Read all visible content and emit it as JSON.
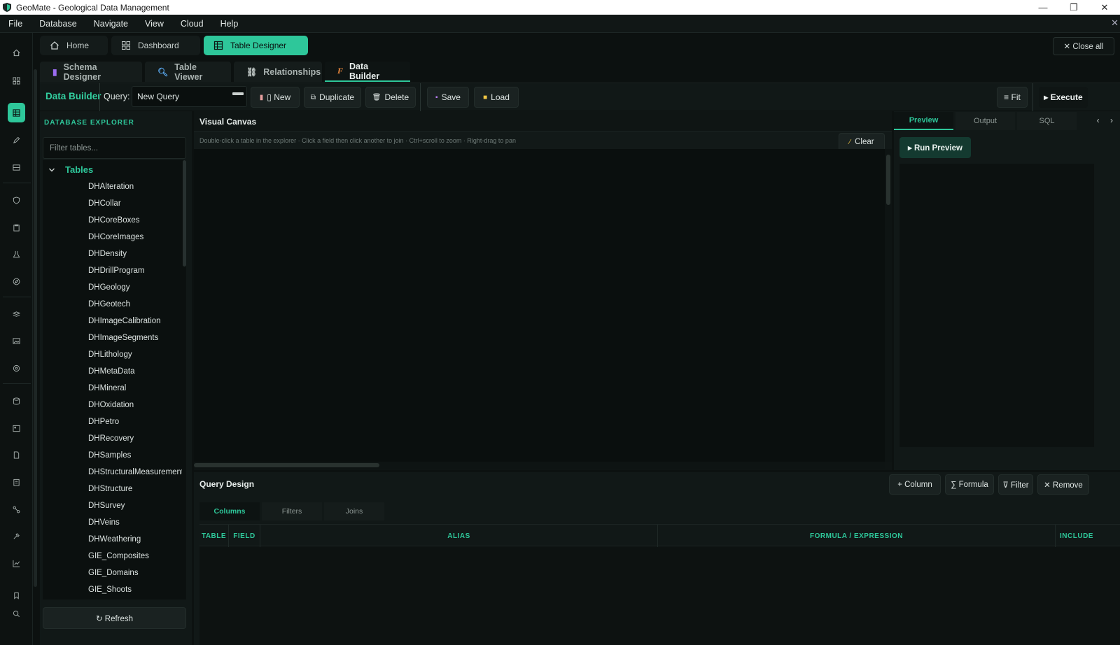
{
  "window": {
    "title": "GeoMate - Geological Data Management",
    "controls": [
      "—",
      "❐",
      "✕"
    ]
  },
  "menu": [
    "File",
    "Database",
    "Navigate",
    "View",
    "Cloud",
    "Help"
  ],
  "menu_close": "✕",
  "top_tabs": [
    {
      "label": "Home",
      "icon": "home-icon"
    },
    {
      "label": "Dashboard",
      "icon": "dashboard-icon"
    },
    {
      "label": "Table Designer",
      "icon": "table-icon",
      "active": true
    }
  ],
  "close_all": "✕  Close all",
  "sub_tabs": [
    {
      "label": "Schema Designer",
      "icon": "schema-icon"
    },
    {
      "label": "Table Viewer",
      "icon": "magnifier-icon"
    },
    {
      "label": "Relationships",
      "icon": "link-icon"
    },
    {
      "label": "Data Builder",
      "icon": "formula-icon",
      "active": true
    }
  ],
  "toolbar": {
    "title": "Data Builder",
    "query_label": "Query:",
    "query_value": "New Query",
    "new": "▯ New",
    "duplicate": "Duplicate",
    "delete": "Delete",
    "save": "Save",
    "load": "Load",
    "fit": "≡ Fit",
    "execute": "▸ Execute"
  },
  "explorer": {
    "title": "DATABASE EXPLORER",
    "filter_placeholder": "Filter tables...",
    "group": "Tables",
    "tables": [
      "DHAlteration",
      "DHCollar",
      "DHCoreBoxes",
      "DHCoreImages",
      "DHDensity",
      "DHDrillProgram",
      "DHGeology",
      "DHGeotech",
      "DHImageCalibration",
      "DHImageSegments",
      "DHLithology",
      "DHMetaData",
      "DHMineral",
      "DHOxidation",
      "DHPetro",
      "DHRecovery",
      "DHSamples",
      "DHStructuralMeasurements",
      "DHStructure",
      "DHSurvey",
      "DHVeins",
      "DHWeathering",
      "GIE_Composites",
      "GIE_Domains",
      "GIE_Shoots"
    ],
    "refresh": "↻ Refresh"
  },
  "canvas": {
    "title": "Visual Canvas",
    "hint": "Double-click a table in the explorer  ·  Click a field then click another to join  ·  Ctrl+scroll to zoom  ·  Right-drag to pan",
    "clear": "Clear"
  },
  "preview": {
    "tabs": [
      "Preview",
      "Output",
      "SQL"
    ],
    "arrows": "‹ ›",
    "run": "▸ Run Preview"
  },
  "query_design": {
    "title": "Query Design",
    "add_column": "+ Column",
    "formula": "∑ Formula",
    "filter": "⊽ Filter",
    "remove": "✕ Remove",
    "tabs": [
      "Columns",
      "Filters",
      "Joins"
    ],
    "headers": [
      "TABLE",
      "FIELD",
      "ALIAS",
      "FORMULA / EXPRESSION",
      "INCLUDE"
    ]
  },
  "colors": {
    "accent": "#2ec79a",
    "background": "#0c1110",
    "panel": "#111817"
  }
}
